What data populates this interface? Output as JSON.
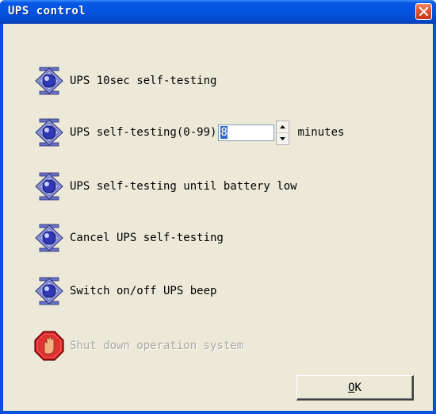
{
  "window": {
    "title": "UPS control",
    "close_icon": "close-icon",
    "colors": {
      "title_bar": "#0554e0",
      "client_bg": "#ece9d8",
      "close_btn": "#e0532c",
      "disabled_text": "#a8a8a0",
      "selection": "#316ac5"
    }
  },
  "operations": [
    {
      "label": "UPS 10sec self-testing",
      "icon": "self-test-icon",
      "enabled": true
    },
    {
      "label": "UPS self-testing(0-99)",
      "icon": "self-test-icon",
      "enabled": true
    },
    {
      "label": "UPS self-testing until battery low",
      "icon": "self-test-icon",
      "enabled": true
    },
    {
      "label": "Cancel UPS self-testing",
      "icon": "self-test-icon",
      "enabled": true
    },
    {
      "label": "Switch on/off UPS beep",
      "icon": "self-test-icon",
      "enabled": true
    },
    {
      "label": "Shut down operation system",
      "icon": "stop-hand-icon",
      "enabled": false
    }
  ],
  "duration": {
    "value": "8",
    "unit": "minutes",
    "up_icon": "spin-up-icon",
    "down_icon": "spin-down-icon"
  },
  "ok_button": {
    "label": "OK",
    "mnemonic": "O",
    "rest": "K"
  }
}
